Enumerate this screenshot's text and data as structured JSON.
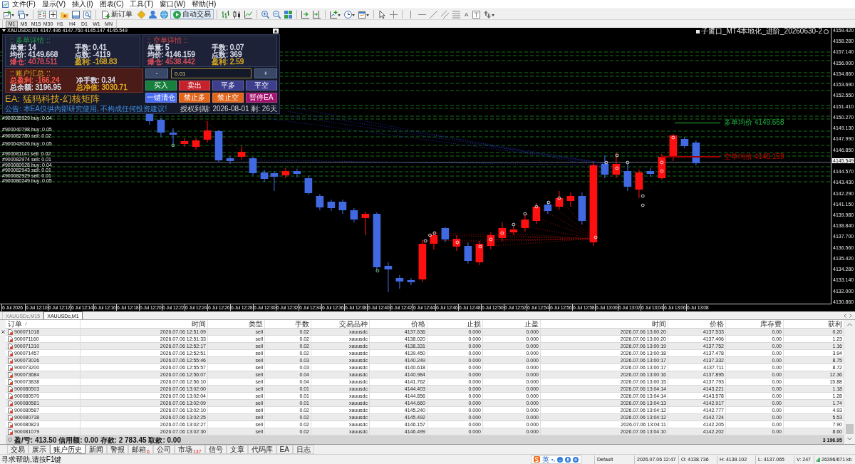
{
  "menu": [
    "文件(F)",
    "显示(V)",
    "插入(I)",
    "图表(C)",
    "工具(T)",
    "窗口(W)",
    "帮助(H)"
  ],
  "toolbar": {
    "new_order": "新订单",
    "auto_trading": {
      "label": "自动交易",
      "on": true
    },
    "text_tool": "A"
  },
  "timeframes": [
    {
      "label": "M1",
      "selected": true
    },
    {
      "label": "M5",
      "selected": false
    },
    {
      "label": "M15",
      "selected": false
    },
    {
      "label": "M30",
      "selected": false
    },
    {
      "label": "H1",
      "selected": false
    },
    {
      "label": "H4",
      "selected": false
    },
    {
      "label": "D1",
      "selected": false
    },
    {
      "label": "W1",
      "selected": false
    },
    {
      "label": "MN",
      "selected": false
    }
  ],
  "chart": {
    "title": "XAUUSDc,M1 4147.496 4147.750 4145.147 4145.549",
    "indicator": "子窗口_MT4本地化_进阶_20260630-2",
    "order_labels": [
      "#900035929 buy: 0.04",
      "#900040798 buy: 0.05",
      "#900082780 sell: 0.02",
      "#900043026 buy: 0.05",
      "#900081141 sell: 0.02",
      "#900082974 sell: 0.01",
      "#900080028 buy: 0.04",
      "#900082943 sell: 0.01",
      "#900082929 sell: 0.01",
      "#900080249 buy: 0.05"
    ],
    "long_average": "多单均价 4149.668",
    "short_average": "空单均价 4146.159",
    "price_axis": {
      "upper": [
        "4159.420",
        "4158.280",
        "4157.140",
        "4156.000",
        "4154.860",
        "4153.690",
        "4152.550",
        "4151.410",
        "4150.270",
        "4149.130",
        "4147.990",
        "4146.850"
      ],
      "current": "4145.549",
      "lower": [
        "4144.570",
        "4143.430",
        "4142.290",
        "4141.150",
        "4139.980",
        "4138.840",
        "4137.700",
        "4136.560",
        "4135.420",
        "4134.280",
        "4133.140",
        "4132.000",
        "4130.860"
      ]
    },
    "time_axis": [
      "6 Jul 2026",
      "6 Jul 12:10",
      "6 Jul 12:12",
      "6 Jul 12:14",
      "6 Jul 12:16",
      "6 Jul 12:18",
      "6 Jul 12:20",
      "6 Jul 12:22",
      "6 Jul 12:24",
      "6 Jul 12:26",
      "6 Jul 12:28",
      "6 Jul 12:30",
      "6 Jul 12:32",
      "6 Jul 12:34",
      "6 Jul 12:36",
      "6 Jul 12:38",
      "6 Jul 12:40",
      "6 Jul 12:42",
      "6 Jul 12:44",
      "6 Jul 12:46",
      "6 Jul 12:48",
      "6 Jul 12:50",
      "6 Jul 12:52",
      "6 Jul 12:54",
      "6 Jul 12:56",
      "6 Jul 12:58",
      "6 Jul 13:00",
      "6 Jul 13:02",
      "6 Jul 13:04",
      "6 Jul 13:06",
      "6 Jul 13:08"
    ]
  },
  "ea_panel": {
    "long": {
      "title": ":: 多单详情 ::",
      "fields": [
        {
          "text": "单量: 14",
          "color": "#dfe3ee"
        },
        {
          "text": "手数: 0.41",
          "color": "#dfe3ee"
        },
        {
          "text": "均价: 4149.668",
          "color": "#dfe3ee"
        },
        {
          "text": "点数: -4119",
          "color": "#dfe3ee"
        },
        {
          "text": "爆仓: 4078.511",
          "color": "#e0505a"
        },
        {
          "text": "盈利: -168.83",
          "color": "#e6b422"
        }
      ]
    },
    "short": {
      "title": ":: 空单详情 ::",
      "fields": [
        {
          "text": "单量: 5",
          "color": "#dfe3ee"
        },
        {
          "text": "手数: 0.07",
          "color": "#dfe3ee"
        },
        {
          "text": "均价: 4146.159",
          "color": "#dfe3ee"
        },
        {
          "text": "点数: 369",
          "color": "#dfe3ee"
        },
        {
          "text": "爆仓: 4538.442",
          "color": "#e0505a"
        },
        {
          "text": "盈利: 2.59",
          "color": "#e6b422"
        }
      ]
    },
    "account": {
      "title": ":: 账户汇总 ::",
      "fields": [
        {
          "text": "总盈利: -166.24",
          "color": "#ff5a4a"
        },
        {
          "text": "净手数: 0.34",
          "color": "#dfe3ee"
        },
        {
          "text": "总余额: 3196.95",
          "color": "#dfe3ee"
        },
        {
          "text": "总净值: 3030.71",
          "color": "#e6b422"
        }
      ]
    },
    "lot": {
      "decrease": "-",
      "value": "0.01",
      "increase": "+"
    },
    "actions": [
      {
        "label": "买入",
        "color": "#17803d"
      },
      {
        "label": "卖出",
        "color": "#c5222c"
      },
      {
        "label": "平多",
        "color": "#3d3f8e"
      },
      {
        "label": "平空",
        "color": "#3d3f8e"
      },
      {
        "label": "一键清仓",
        "color": "#4a6cf2"
      },
      {
        "label": "禁止多",
        "color": "#e2651c"
      },
      {
        "label": "禁止空",
        "color": "#e2651c"
      },
      {
        "label": "暂停EA",
        "color": "#a3136e"
      }
    ],
    "title": "EA: 猛犸科技-幻核矩阵",
    "notice": "公告: 本EA仅供内部研究使用, 不构成任何投资建议!",
    "license": "授权到期: 2026-08-01 剩: 26天"
  },
  "chart_tabs": [
    {
      "label": "XAUUSDc,M15",
      "selected": false
    },
    {
      "label": "XAUUSDc,M1",
      "selected": true
    }
  ],
  "history": {
    "columns": [
      "订单",
      "时间",
      "类型",
      "手数",
      "交易品种",
      "价格",
      "止损",
      "止盈",
      "时间",
      "价格",
      "库存费",
      "获利"
    ],
    "rows": [
      [
        "900071018",
        "2026.07.06 12:51:09",
        "sell",
        "0.02",
        "xauusdc",
        "4137.636",
        "0.000",
        "0.000",
        "2026.07.06 13:00:20",
        "4137.533",
        "0.00",
        "0.20"
      ],
      [
        "900071160",
        "2026.07.06 12:51:33",
        "sell",
        "0.02",
        "xauusdc",
        "4138.020",
        "0.000",
        "0.000",
        "2026.07.06 13:00:20",
        "4137.406",
        "0.00",
        "1.23"
      ],
      [
        "900071310",
        "2026.07.06 12:52:17",
        "sell",
        "0.02",
        "xauusdc",
        "4138.331",
        "0.000",
        "0.000",
        "2026.07.06 13:00:19",
        "4137.752",
        "0.00",
        "1.16"
      ],
      [
        "900071457",
        "2026.07.06 12:52:51",
        "sell",
        "0.02",
        "xauusdc",
        "4139.450",
        "0.000",
        "0.000",
        "2026.07.06 13:00:18",
        "4137.478",
        "0.00",
        "3.94"
      ],
      [
        "900073026",
        "2026.07.06 12:55:46",
        "sell",
        "0.03",
        "xauusdc",
        "4140.249",
        "0.000",
        "0.000",
        "2026.07.06 13:00:17",
        "4137.332",
        "0.00",
        "8.75"
      ],
      [
        "900073200",
        "2026.07.06 12:55:57",
        "sell",
        "0.03",
        "xauusdc",
        "4140.618",
        "0.000",
        "0.000",
        "2026.07.06 13:00:17",
        "4137.711",
        "0.00",
        "8.72"
      ],
      [
        "900073684",
        "2026.07.06 12:56:07",
        "sell",
        "0.04",
        "xauusdc",
        "4140.984",
        "0.000",
        "0.000",
        "2026.07.06 13:00:16",
        "4137.895",
        "0.00",
        "12.36"
      ],
      [
        "900073838",
        "2026.07.06 12:56:10",
        "sell",
        "0.04",
        "xauusdc",
        "4141.762",
        "0.000",
        "0.000",
        "2026.07.06 13:00:15",
        "4137.793",
        "0.00",
        "15.88"
      ],
      [
        "900080503",
        "2026.07.06 13:02:00",
        "sell",
        "0.01",
        "xauusdc",
        "4144.403",
        "0.000",
        "0.000",
        "2026.07.06 13:04:14",
        "4143.221",
        "0.00",
        "1.18"
      ],
      [
        "900080570",
        "2026.07.06 13:02:04",
        "sell",
        "0.01",
        "xauusdc",
        "4144.856",
        "0.000",
        "0.000",
        "2026.07.06 13:04:14",
        "4143.578",
        "0.00",
        "1.28"
      ],
      [
        "900080581",
        "2026.07.06 13:02:09",
        "sell",
        "0.01",
        "xauusdc",
        "4144.660",
        "0.000",
        "0.000",
        "2026.07.06 13:04:13",
        "4142.917",
        "0.00",
        "1.74"
      ],
      [
        "900080587",
        "2026.07.06 13:02:10",
        "sell",
        "0.02",
        "xauusdc",
        "4145.240",
        "0.000",
        "0.000",
        "2026.07.06 13:04:12",
        "4142.777",
        "0.00",
        "4.93"
      ],
      [
        "900080738",
        "2026.07.06 13:02:25",
        "sell",
        "0.02",
        "xauusdc",
        "4145.492",
        "0.000",
        "0.000",
        "2026.07.06 13:04:12",
        "4142.724",
        "0.00",
        "5.53"
      ],
      [
        "900080823",
        "2026.07.06 13:02:27",
        "sell",
        "0.02",
        "xauusdc",
        "4146.157",
        "0.000",
        "0.000",
        "2026.07.06 13:04:11",
        "4142.205",
        "0.00",
        "7.90"
      ],
      [
        "900081079",
        "2026.07.06 13:02:30",
        "sell",
        "0.02",
        "xauusdc",
        "4146.499",
        "0.000",
        "0.000",
        "2026.07.06 13:04:10",
        "4142.202",
        "0.00",
        "8.60"
      ]
    ],
    "summary": "盈/亏: 413.50  信用额: 0.00  存款: 2 783.45  取款: 0.00",
    "total": "3 196.95"
  },
  "terminal_tabs": [
    {
      "label": "交易",
      "selected": false
    },
    {
      "label": "展示",
      "selected": false
    },
    {
      "label": "账户历史",
      "selected": true
    },
    {
      "label": "新闻",
      "selected": false
    },
    {
      "label": "警报",
      "selected": false
    },
    {
      "label": "邮箱$_{6}$",
      "selected": false
    },
    {
      "label": "公司",
      "selected": false
    },
    {
      "label": "市场$_{137}$",
      "selected": false
    },
    {
      "label": "信号",
      "selected": false
    },
    {
      "label": "文章",
      "selected": false
    },
    {
      "label": "代码库",
      "selected": false
    },
    {
      "label": "EA",
      "selected": false
    },
    {
      "label": "日志",
      "selected": false
    }
  ],
  "status_bar": {
    "help": "寻求帮助,请按F1键",
    "input_mode": "英",
    "profile": "Default",
    "time": "2026.07.06 12:47",
    "open": "O: 4138.736",
    "high": "H: 4139.102",
    "low": "L: 4137.065",
    "volume": "V: 247",
    "traffic": "26396/671 kb"
  }
}
